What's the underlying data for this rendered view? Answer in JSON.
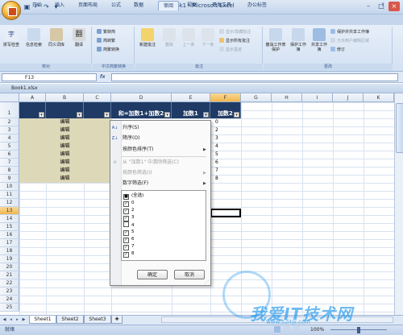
{
  "app": {
    "title": "Book1 - Microsoft Excel",
    "workbook_name": "Book1.xlsx",
    "window_buttons": [
      "–",
      "□",
      "×"
    ],
    "qat_icons": [
      "save-icon",
      "undo-icon",
      "redo-icon"
    ]
  },
  "ribbon": {
    "tabs": [
      "开始",
      "插入",
      "页面布局",
      "公式",
      "数据",
      "审阅",
      "视图",
      "开发工具",
      "办公标签"
    ],
    "active_tab": "审阅",
    "groups": [
      {
        "label": "校对",
        "buttons": [
          "拼写检查",
          "信息检索",
          "同义词库",
          "翻译"
        ]
      },
      {
        "label": "中文简繁转换",
        "buttons": [
          "繁转简",
          "简转繁",
          "简繁转换"
        ]
      },
      {
        "label": "批注",
        "buttons": [
          "新建批注",
          "删除",
          "上一条",
          "下一条"
        ],
        "small": [
          "显示/隐藏批注",
          "显示所有批注",
          "显示墨迹"
        ]
      },
      {
        "label": "更改",
        "buttons": [
          "撤消工作表保护",
          "保护工作簿",
          "共享工作簿"
        ],
        "small": [
          "保护并共享工作簿",
          "允许用户编辑区域",
          "修订"
        ]
      }
    ]
  },
  "formula_bar": {
    "name_box": "F13",
    "fx": "fx",
    "value": ""
  },
  "sheet": {
    "columns": [
      "A",
      "B",
      "C",
      "D",
      "E",
      "F",
      "G",
      "H",
      "I",
      "J",
      "K"
    ],
    "selected_column": "F",
    "rows": [
      "1",
      "2",
      "3",
      "4",
      "5",
      "6",
      "7",
      "8",
      "9",
      "10",
      "11",
      "12",
      "13",
      "14",
      "15",
      "16",
      "17",
      "18",
      "19",
      "20",
      "21",
      "22",
      "23",
      "24",
      "25",
      "26"
    ],
    "selected_row": "13",
    "header_row": {
      "d": "和=加数1+加数2",
      "e": "加数1",
      "f": "加数2"
    },
    "b_values": [
      "编辑",
      "编辑",
      "编辑",
      "编辑",
      "编辑",
      "编辑",
      "编辑",
      "编辑"
    ],
    "f_values": [
      "0",
      "2",
      "3",
      "4",
      "5",
      "6",
      "7",
      "8"
    ]
  },
  "filter_menu": {
    "sort_asc": "升序(S)",
    "sort_desc": "降序(O)",
    "sort_color": "按颜色排序(T)",
    "clear_filter": "从 \"加数1\" 中清除筛选(C)",
    "filter_color": "按颜色筛选(I)",
    "number_filter": "数字筛选(F)",
    "list": [
      {
        "label": "(全选)",
        "checked": "mixed"
      },
      {
        "label": "0",
        "checked": true
      },
      {
        "label": "2",
        "checked": true
      },
      {
        "label": "3",
        "checked": true
      },
      {
        "label": "4",
        "checked": false
      },
      {
        "label": "5",
        "checked": true
      },
      {
        "label": "6",
        "checked": true
      },
      {
        "label": "7",
        "checked": true
      },
      {
        "label": "8",
        "checked": true
      }
    ],
    "ok": "确定",
    "cancel": "取消"
  },
  "sheet_tabs": [
    "Sheet1",
    "Sheet2",
    "Sheet3"
  ],
  "active_sheet": "Sheet1",
  "status": {
    "ready": "就绪",
    "zoom": "100%"
  },
  "watermark": {
    "text": "我爱IT技术网",
    "url": "www.52itjs.com"
  },
  "colors": {
    "header_fill": "#1f3a64",
    "tan_fill": "#ddd8b8",
    "selection": "#f1b64b"
  }
}
